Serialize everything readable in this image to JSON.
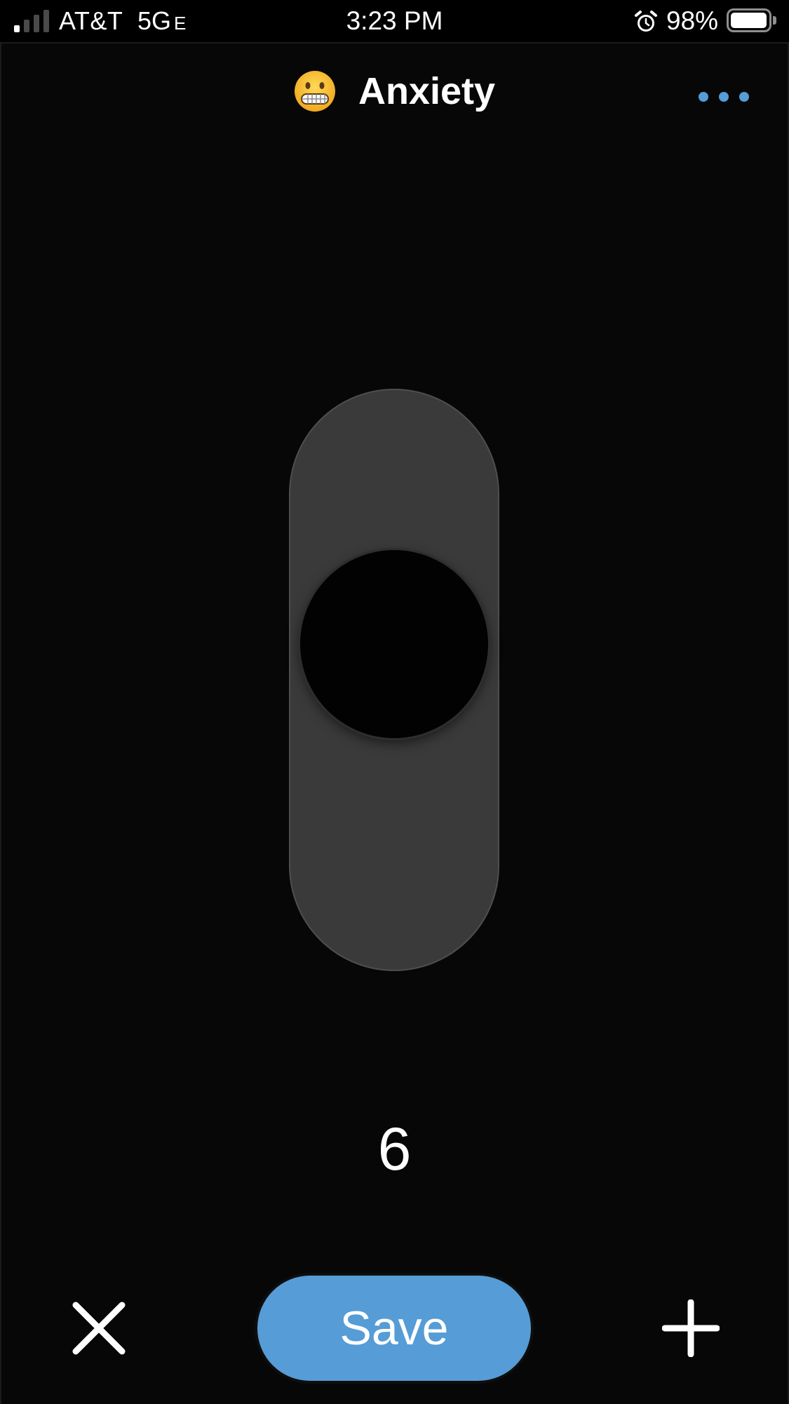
{
  "status_bar": {
    "carrier": "AT&T",
    "network": "5G",
    "network_suffix": "E",
    "time": "3:23 PM",
    "battery_percent": "98%",
    "battery_level": 0.98,
    "signal_bars_on": 1,
    "signal_bars_total": 4,
    "icons": {
      "signal": "signal-bars-icon",
      "alarm": "alarm-clock-icon",
      "battery": "battery-icon"
    }
  },
  "header": {
    "emoji_icon": "grimacing-face-icon",
    "title": "Anxiety",
    "more_icon": "more-dots-icon"
  },
  "slider": {
    "value": "6",
    "track_color": "#3a3a3a",
    "knob_color": "#020202"
  },
  "footer": {
    "close_icon": "close-icon",
    "save_label": "Save",
    "add_icon": "plus-icon"
  },
  "colors": {
    "accent": "#569cd6",
    "background": "#070707",
    "text": "#ffffff"
  }
}
